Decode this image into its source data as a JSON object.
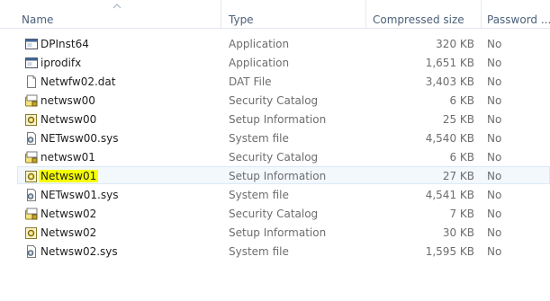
{
  "columns": {
    "name": "Name",
    "type": "Type",
    "compressed_size": "Compressed size",
    "password": "Password ..."
  },
  "files": [
    {
      "name": "DPInst64",
      "type": "Application",
      "size": "320 KB",
      "password": "No",
      "icon": "application-icon"
    },
    {
      "name": "iprodifx",
      "type": "Application",
      "size": "1,651 KB",
      "password": "No",
      "icon": "application-icon"
    },
    {
      "name": "Netwfw02.dat",
      "type": "DAT File",
      "size": "3,403 KB",
      "password": "No",
      "icon": "blank-file-icon"
    },
    {
      "name": "netwsw00",
      "type": "Security Catalog",
      "size": "6 KB",
      "password": "No",
      "icon": "security-catalog-icon"
    },
    {
      "name": "Netwsw00",
      "type": "Setup Information",
      "size": "25 KB",
      "password": "No",
      "icon": "setup-info-icon"
    },
    {
      "name": "NETwsw00.sys",
      "type": "System file",
      "size": "4,540 KB",
      "password": "No",
      "icon": "system-file-icon"
    },
    {
      "name": "netwsw01",
      "type": "Security Catalog",
      "size": "6 KB",
      "password": "No",
      "icon": "security-catalog-icon"
    },
    {
      "name": "Netwsw01",
      "type": "Setup Information",
      "size": "27 KB",
      "password": "No",
      "icon": "setup-info-icon",
      "selected": true,
      "highlighted": true
    },
    {
      "name": "NETwsw01.sys",
      "type": "System file",
      "size": "4,541 KB",
      "password": "No",
      "icon": "system-file-icon"
    },
    {
      "name": "Netwsw02",
      "type": "Security Catalog",
      "size": "7 KB",
      "password": "No",
      "icon": "security-catalog-icon"
    },
    {
      "name": "Netwsw02",
      "type": "Setup Information",
      "size": "30 KB",
      "password": "No",
      "icon": "setup-info-icon"
    },
    {
      "name": "Netwsw02.sys",
      "type": "System file",
      "size": "1,595 KB",
      "password": "No",
      "icon": "system-file-icon"
    }
  ],
  "colors": {
    "highlight": "#f5ff00",
    "selection_bg": "#f3f8fd",
    "selection_border": "#dbe9f7",
    "header_text": "#4c607a",
    "secondary_text": "#6d6d6d"
  }
}
